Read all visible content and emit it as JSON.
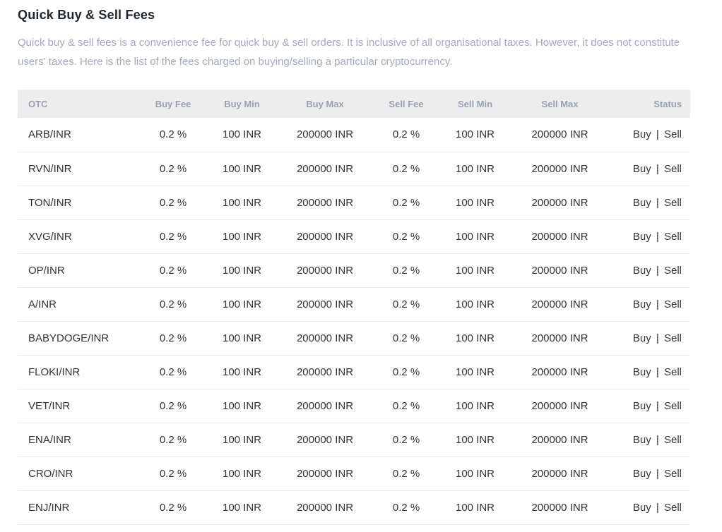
{
  "header": {
    "title": "Quick Buy & Sell Fees",
    "description": "Quick buy & sell fees is a convenience fee for quick buy & sell orders. It is inclusive of all organisational taxes. However, it does not constitute users' taxes. Here is the list of the fees charged on buying/selling a particular cryptocurrency."
  },
  "table": {
    "headers": [
      "OTC",
      "Buy Fee",
      "Buy Min",
      "Buy Max",
      "Sell Fee",
      "Sell Min",
      "Sell Max",
      "Status"
    ],
    "labels": {
      "status_divider": "|"
    },
    "rows": [
      {
        "pair": "ARB/INR",
        "buy_fee": "0.2 %",
        "buy_min": "100 INR",
        "buy_max": "200000 INR",
        "sell_fee": "0.2 %",
        "sell_min": "100 INR",
        "sell_max": "200000 INR",
        "status_buy": "Buy",
        "status_sell": "Sell"
      },
      {
        "pair": "RVN/INR",
        "buy_fee": "0.2 %",
        "buy_min": "100 INR",
        "buy_max": "200000 INR",
        "sell_fee": "0.2 %",
        "sell_min": "100 INR",
        "sell_max": "200000 INR",
        "status_buy": "Buy",
        "status_sell": "Sell"
      },
      {
        "pair": "TON/INR",
        "buy_fee": "0.2 %",
        "buy_min": "100 INR",
        "buy_max": "200000 INR",
        "sell_fee": "0.2 %",
        "sell_min": "100 INR",
        "sell_max": "200000 INR",
        "status_buy": "Buy",
        "status_sell": "Sell"
      },
      {
        "pair": "XVG/INR",
        "buy_fee": "0.2 %",
        "buy_min": "100 INR",
        "buy_max": "200000 INR",
        "sell_fee": "0.2 %",
        "sell_min": "100 INR",
        "sell_max": "200000 INR",
        "status_buy": "Buy",
        "status_sell": "Sell"
      },
      {
        "pair": "OP/INR",
        "buy_fee": "0.2 %",
        "buy_min": "100 INR",
        "buy_max": "200000 INR",
        "sell_fee": "0.2 %",
        "sell_min": "100 INR",
        "sell_max": "200000 INR",
        "status_buy": "Buy",
        "status_sell": "Sell"
      },
      {
        "pair": "A/INR",
        "buy_fee": "0.2 %",
        "buy_min": "100 INR",
        "buy_max": "200000 INR",
        "sell_fee": "0.2 %",
        "sell_min": "100 INR",
        "sell_max": "200000 INR",
        "status_buy": "Buy",
        "status_sell": "Sell"
      },
      {
        "pair": "BABYDOGE/INR",
        "buy_fee": "0.2 %",
        "buy_min": "100 INR",
        "buy_max": "200000 INR",
        "sell_fee": "0.2 %",
        "sell_min": "100 INR",
        "sell_max": "200000 INR",
        "status_buy": "Buy",
        "status_sell": "Sell"
      },
      {
        "pair": "FLOKI/INR",
        "buy_fee": "0.2 %",
        "buy_min": "100 INR",
        "buy_max": "200000 INR",
        "sell_fee": "0.2 %",
        "sell_min": "100 INR",
        "sell_max": "200000 INR",
        "status_buy": "Buy",
        "status_sell": "Sell"
      },
      {
        "pair": "VET/INR",
        "buy_fee": "0.2 %",
        "buy_min": "100 INR",
        "buy_max": "200000 INR",
        "sell_fee": "0.2 %",
        "sell_min": "100 INR",
        "sell_max": "200000 INR",
        "status_buy": "Buy",
        "status_sell": "Sell"
      },
      {
        "pair": "ENA/INR",
        "buy_fee": "0.2 %",
        "buy_min": "100 INR",
        "buy_max": "200000 INR",
        "sell_fee": "0.2 %",
        "sell_min": "100 INR",
        "sell_max": "200000 INR",
        "status_buy": "Buy",
        "status_sell": "Sell"
      },
      {
        "pair": "CRO/INR",
        "buy_fee": "0.2 %",
        "buy_min": "100 INR",
        "buy_max": "200000 INR",
        "sell_fee": "0.2 %",
        "sell_min": "100 INR",
        "sell_max": "200000 INR",
        "status_buy": "Buy",
        "status_sell": "Sell"
      },
      {
        "pair": "ENJ/INR",
        "buy_fee": "0.2 %",
        "buy_min": "100 INR",
        "buy_max": "200000 INR",
        "sell_fee": "0.2 %",
        "sell_min": "100 INR",
        "sell_max": "200000 INR",
        "status_buy": "Buy",
        "status_sell": "Sell"
      }
    ]
  },
  "colors": {
    "page_background": "#ffffff",
    "title_text": "#1f2630",
    "description_text": "#a3aaba",
    "header_background": "#ededee",
    "header_text": "#99a1b0",
    "cell_text": "#30333a",
    "row_divider": "#ebebeb"
  }
}
